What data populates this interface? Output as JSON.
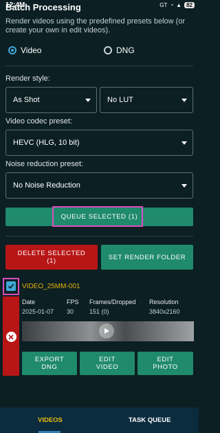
{
  "status_bar": {
    "time": "12:4M",
    "signal": "GT",
    "battery": "82"
  },
  "header": {
    "title": "Batch Processing",
    "subtitle": "Render videos using the predefined presets below (or create your own in edit videos)."
  },
  "mode": {
    "options": [
      "Video",
      "DNG"
    ],
    "selected": "Video"
  },
  "render_style": {
    "label": "Render style:",
    "style_value": "As Shot",
    "lut_value": "No LUT"
  },
  "codec": {
    "label": "Video codec preset:",
    "value": "HEVC (HLG, 10 bit)"
  },
  "noise": {
    "label": "Noise reduction preset:",
    "value": "No Noise Reduction"
  },
  "actions": {
    "queue_selected": "QUEUE SELECTED (1)",
    "delete_selected": "DELETE SELECTED\n(1)",
    "set_render_folder": "SET RENDER FOLDER"
  },
  "video_item": {
    "name": "VIDEO_25MM-001",
    "headers": [
      "Date",
      "FPS",
      "Frames/Dropped",
      "Resolution"
    ],
    "values": [
      "2025-01-07",
      "30",
      "151 (0)",
      "3840x2160"
    ],
    "buttons": [
      "EXPORT\nDNG",
      "EDIT\nVIDEO",
      "EDIT\nPHOTO"
    ]
  },
  "tabs": [
    {
      "label": "VIDEOS",
      "active": true
    },
    {
      "label": "TASK QUEUE",
      "active": false
    }
  ],
  "colors": {
    "accent": "#40a8d8",
    "green": "#1f8a6c",
    "red": "#b81616",
    "highlight": "#d94fbe",
    "tab_active": "#e8bd0b"
  }
}
